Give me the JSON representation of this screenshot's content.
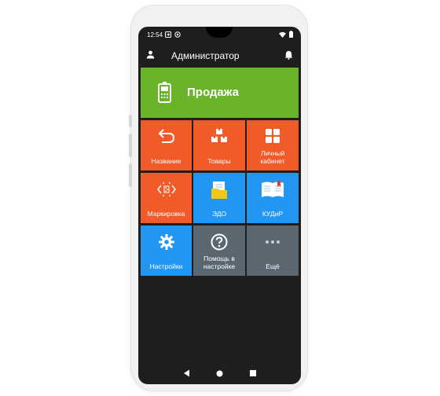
{
  "status_bar": {
    "time": "12:54",
    "icons": [
      "notification-icon",
      "location-icon",
      "wifi-icon",
      "battery-icon"
    ]
  },
  "app_bar": {
    "title": "Администратор",
    "left_icon": "user-icon",
    "right_icon": "bell-icon"
  },
  "sale_button": {
    "label": "Продажа",
    "icon": "payment-terminal-icon",
    "color": "#6ab42a"
  },
  "tiles": [
    {
      "label": "Название",
      "icon": "undo-arrow-icon",
      "color": "#f15a29"
    },
    {
      "label": "Товары",
      "icon": "boxes-icon",
      "color": "#f15a29"
    },
    {
      "label": "Личный кабинет",
      "icon": "grid-icon",
      "color": "#f15a29"
    },
    {
      "label": "Маркировка",
      "icon": "barcode-scan-icon",
      "color": "#f15a29"
    },
    {
      "label": "ЭДО",
      "icon": "document-folder-icon",
      "color": "#2196f3"
    },
    {
      "label": "КУДиР",
      "icon": "book-icon",
      "color": "#2196f3"
    },
    {
      "label": "Настройки",
      "icon": "gear-icon",
      "color": "#2196f3"
    },
    {
      "label": "Помощь в настройке",
      "icon": "help-icon",
      "color": "#5b6770"
    },
    {
      "label": "Ещё",
      "icon": "more-icon",
      "color": "#5b6770"
    }
  ],
  "nav_bar": {
    "icons": [
      "back-icon",
      "home-icon",
      "recents-icon"
    ]
  }
}
